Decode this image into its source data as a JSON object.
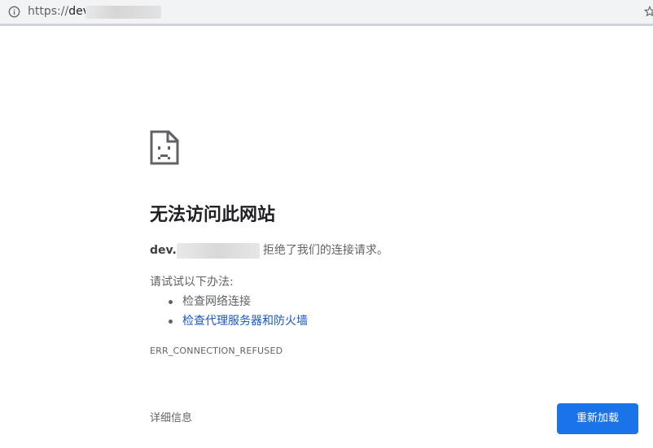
{
  "address_bar": {
    "scheme": "https://",
    "host_prefix": "dev."
  },
  "error": {
    "icon": "sad-document-icon",
    "title": "无法访问此网站",
    "host_prefix": "dev.",
    "message": "拒绝了我们的连接请求。",
    "suggestions_title": "请试试以下办法:",
    "suggestions": [
      {
        "label": "检查网络连接",
        "is_link": false
      },
      {
        "label": "检查代理服务器和防火墙",
        "is_link": true
      }
    ],
    "code": "ERR_CONNECTION_REFUSED"
  },
  "footer": {
    "details_label": "详细信息",
    "reload_label": "重新加载"
  },
  "colors": {
    "primary_button": "#1a73e8",
    "link": "#1a55c8",
    "text": "#202124",
    "secondary_text": "#5f6368"
  }
}
